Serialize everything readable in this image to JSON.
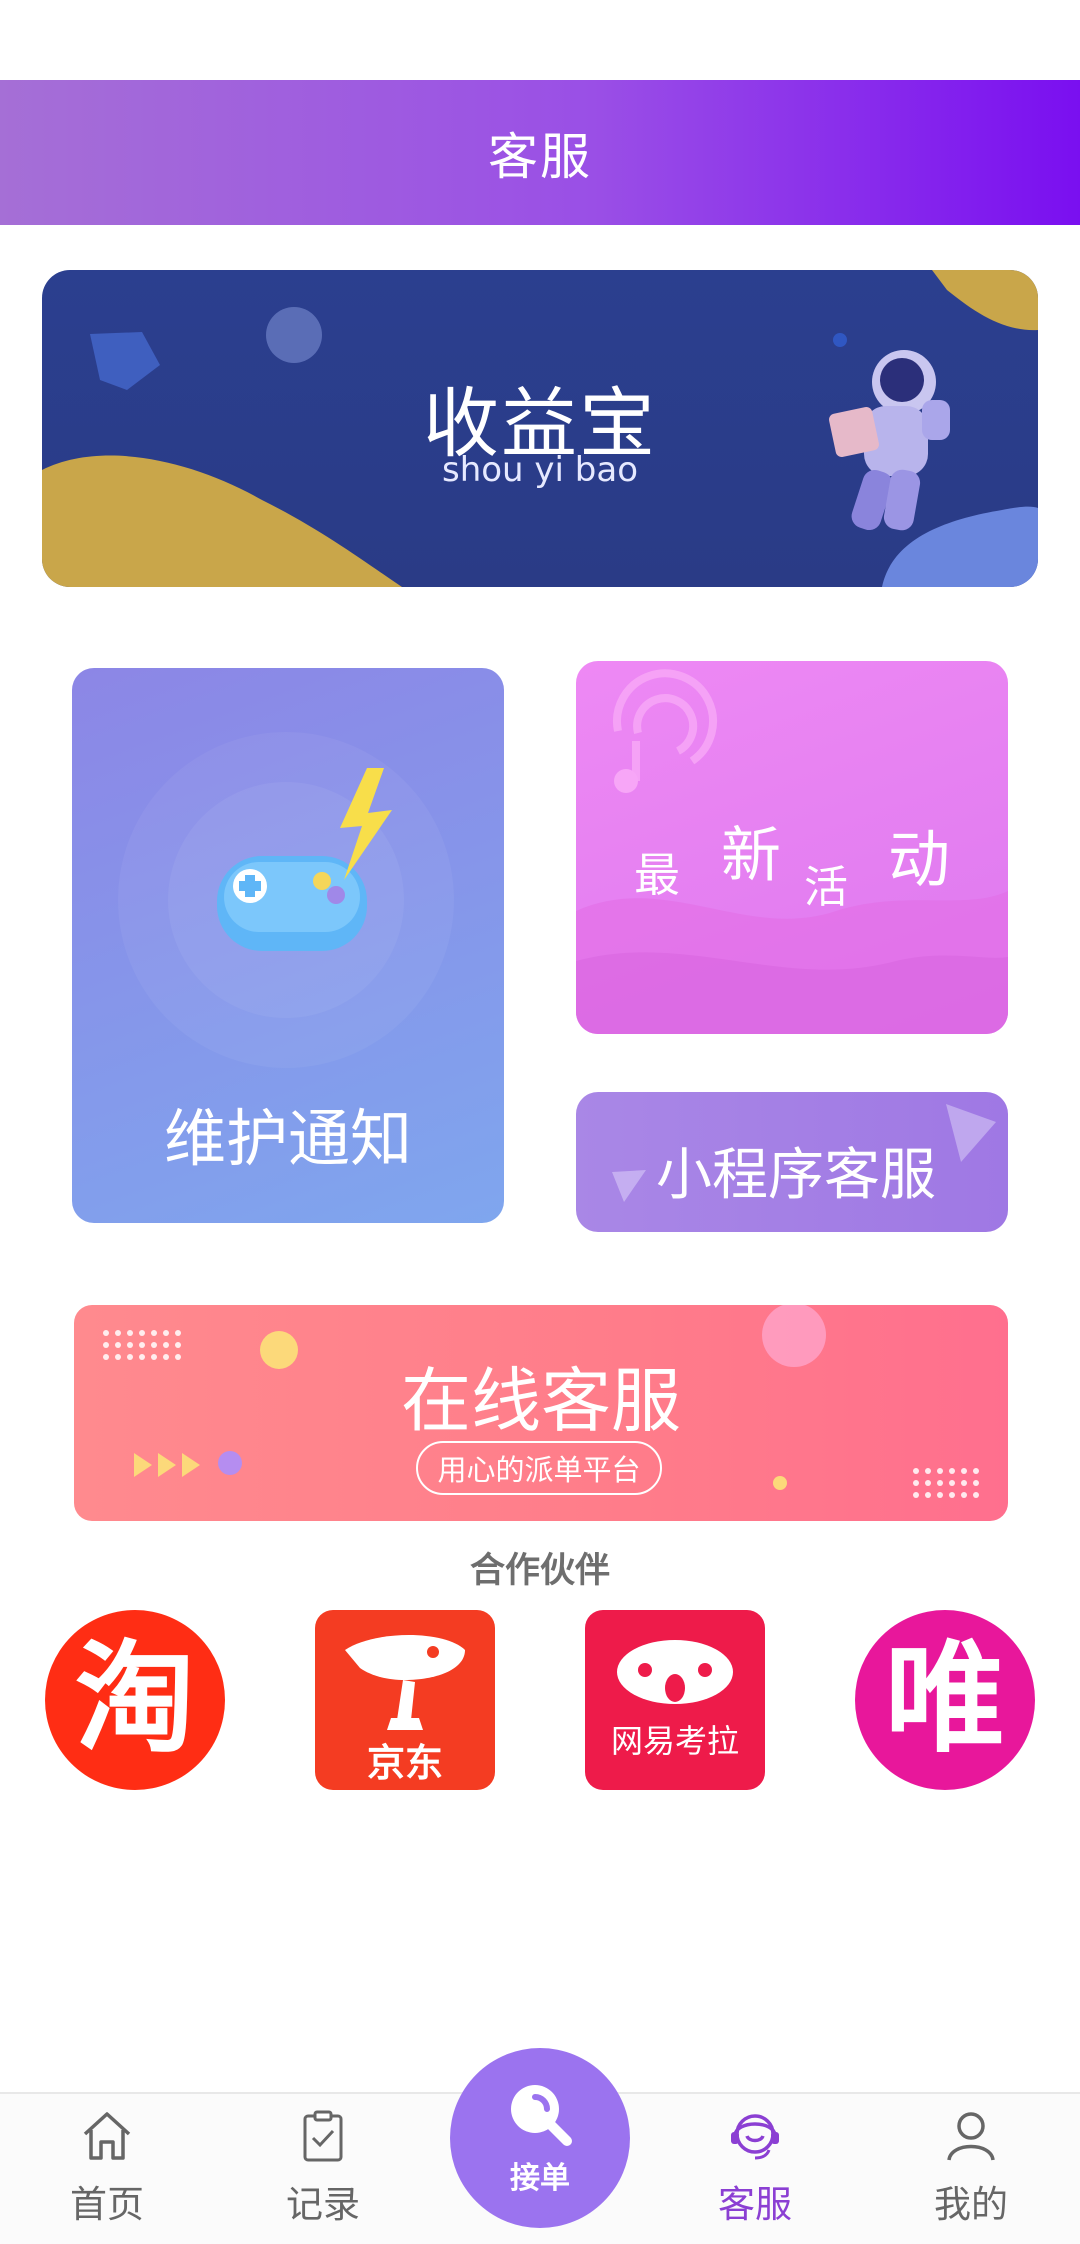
{
  "header": {
    "title": "客服"
  },
  "banner": {
    "title": "收益宝",
    "subtitle": "shou yi bao"
  },
  "cards": {
    "maintenance": "维护通知",
    "event_chars": [
      "最",
      "新",
      "活",
      "动"
    ],
    "mini_program": "小程序客服",
    "online": {
      "title": "在线客服",
      "tagline": "用心的派单平台"
    }
  },
  "partners": {
    "title": "合作伙伴",
    "items": [
      {
        "name": "taobao",
        "glyph": "淘"
      },
      {
        "name": "jd",
        "glyph": "京东"
      },
      {
        "name": "kaola",
        "glyph": "网易考拉"
      },
      {
        "name": "vip",
        "glyph": "唯"
      }
    ]
  },
  "tabbar": {
    "home": "首页",
    "record": "记录",
    "center": "接单",
    "service": "客服",
    "mine": "我的",
    "active": "service"
  },
  "colors": {
    "accent": "#8b3fd3",
    "header_start": "#a56fd6",
    "header_end": "#7a0ff0"
  }
}
